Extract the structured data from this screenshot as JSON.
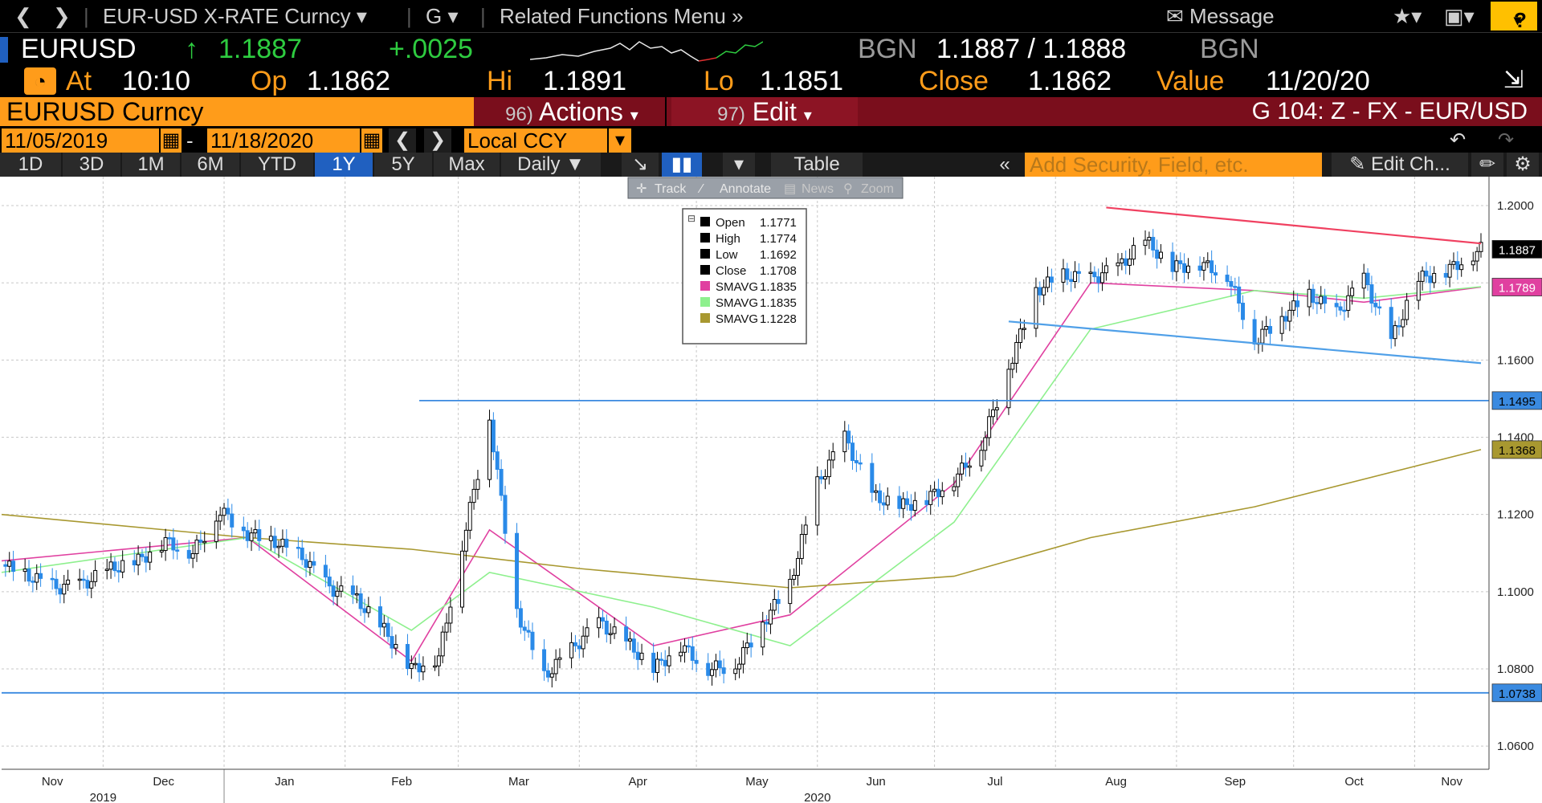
{
  "nav": {
    "ticker_title": "EUR-USD X-RATE Curncy",
    "g_menu": "G",
    "related": "Related Functions Menu",
    "message": "Message",
    "help": "?"
  },
  "quote": {
    "symbol": "EURUSD",
    "arrow": "↑",
    "last": "1.1887",
    "change": "+.0025",
    "source_left": "BGN",
    "bid_ask": "1.1887 / 1.1888",
    "source_right": "BGN"
  },
  "stats": {
    "at_label": "At",
    "at_value": "10:10",
    "op_label": "Op",
    "op_value": "1.1862",
    "hi_label": "Hi",
    "hi_value": "1.1891",
    "lo_label": "Lo",
    "lo_value": "1.1851",
    "close_label": "Close",
    "close_value": "1.1862",
    "value_label": "Value",
    "value_date": "11/20/20"
  },
  "secbar": {
    "name": "EURUSD Curncy",
    "actions_num": "96)",
    "actions": "Actions",
    "edit_num": "97)",
    "edit": "Edit",
    "title": "G 104: Z - FX - EUR/USD"
  },
  "daterange": {
    "start": "11/05/2019",
    "dash": "-",
    "end": "11/18/2020",
    "currency": "Local CCY"
  },
  "periods": [
    "1D",
    "3D",
    "1M",
    "6M",
    "YTD",
    "1Y",
    "5Y",
    "Max"
  ],
  "active_period": "1Y",
  "toolbar": {
    "frequency": "Daily",
    "table": "Table",
    "add_placeholder": "Add Security, Field, etc.",
    "edit_chart": "Edit Ch..."
  },
  "tools": {
    "track": "Track",
    "annotate": "Annotate",
    "news": "News",
    "zoom": "Zoom"
  },
  "legend": [
    {
      "label": "Open",
      "value": "1.1771",
      "color": "#000000"
    },
    {
      "label": "High",
      "value": "1.1774",
      "color": "#000000"
    },
    {
      "label": "Low",
      "value": "1.1692",
      "color": "#000000"
    },
    {
      "label": "Close",
      "value": "1.1708",
      "color": "#000000"
    },
    {
      "label": "SMAVG",
      "value": "1.1835",
      "color": "#e040a0"
    },
    {
      "label": "SMAVG",
      "value": "1.1835",
      "color": "#8ef08e"
    },
    {
      "label": "SMAVG",
      "value": "1.1228",
      "color": "#a89830"
    }
  ],
  "colors": {
    "brand_orange": "#ff9c1a",
    "up_candle": "#000000",
    "down_candle": "#2a8ae8",
    "resistance": "#f04060",
    "support": "#50a0e8",
    "hline": "#3a8ae0",
    "sma_fast": "#e040a0",
    "sma_mid": "#8ef08e",
    "sma_slow": "#a89830"
  },
  "chart_data": {
    "type": "line",
    "title": "",
    "ylim": [
      1.054,
      1.2075
    ],
    "y_ticks": [
      "1.2000",
      "1.1800",
      "1.1600",
      "1.1400",
      "1.1200",
      "1.1000",
      "1.0800",
      "1.0600"
    ],
    "x_month_labels": [
      "Nov",
      "Dec",
      "Jan",
      "Feb",
      "Mar",
      "Apr",
      "May",
      "Jun",
      "Jul",
      "Aug",
      "Sep",
      "Oct",
      "Nov"
    ],
    "x_year_labels": [
      "2019",
      "2020"
    ],
    "series": [
      {
        "name": "",
        "dates": [
          "2019-11-05",
          "2019-11-12",
          "2019-11-19",
          "2019-11-26",
          "2019-12-03",
          "2019-12-10",
          "2019-12-17",
          "2019-12-24",
          "2019-12-31",
          "2020-01-07",
          "2020-01-14",
          "2020-01-21",
          "2020-01-28",
          "2020-02-04",
          "2020-02-11",
          "2020-02-18",
          "2020-02-25",
          "2020-03-02",
          "2020-03-09",
          "2020-03-16",
          "2020-03-23",
          "2020-03-30",
          "2020-04-06",
          "2020-04-13",
          "2020-04-20",
          "2020-04-27",
          "2020-05-04",
          "2020-05-11",
          "2020-05-18",
          "2020-05-25",
          "2020-06-01",
          "2020-06-08",
          "2020-06-15",
          "2020-06-22",
          "2020-06-29",
          "2020-07-06",
          "2020-07-13",
          "2020-07-20",
          "2020-07-27",
          "2020-08-03",
          "2020-08-10",
          "2020-08-17",
          "2020-08-24",
          "2020-08-31",
          "2020-09-07",
          "2020-09-14",
          "2020-09-21",
          "2020-09-28",
          "2020-10-05",
          "2020-10-12",
          "2020-10-19",
          "2020-10-26",
          "2020-11-02",
          "2020-11-09",
          "2020-11-18"
        ],
        "close": [
          1.107,
          1.104,
          1.101,
          1.102,
          1.106,
          1.108,
          1.113,
          1.11,
          1.121,
          1.115,
          1.113,
          1.109,
          1.101,
          1.098,
          1.09,
          1.08,
          1.083,
          1.112,
          1.145,
          1.095,
          1.078,
          1.085,
          1.092,
          1.087,
          1.08,
          1.086,
          1.08,
          1.081,
          1.092,
          1.102,
          1.128,
          1.14,
          1.125,
          1.122,
          1.124,
          1.129,
          1.138,
          1.158,
          1.178,
          1.182,
          1.181,
          1.184,
          1.191,
          1.184,
          1.185,
          1.182,
          1.165,
          1.171,
          1.177,
          1.172,
          1.181,
          1.165,
          1.181,
          1.183,
          1.1887
        ]
      },
      {
        "name": "",
        "dates": [
          "2019-11-05",
          "2020-01-07",
          "2020-02-18",
          "2020-03-09",
          "2020-04-20",
          "2020-05-25",
          "2020-07-06",
          "2020-08-10",
          "2020-09-21",
          "2020-10-19",
          "2020-11-18"
        ],
        "values": [
          1.108,
          1.114,
          1.082,
          1.116,
          1.086,
          1.094,
          1.128,
          1.18,
          1.178,
          1.175,
          1.1789
        ]
      },
      {
        "name": "",
        "dates": [
          "2019-11-05",
          "2020-01-07",
          "2020-02-18",
          "2020-03-09",
          "2020-04-20",
          "2020-05-25",
          "2020-07-06",
          "2020-08-10",
          "2020-09-21",
          "2020-10-19",
          "2020-11-18"
        ],
        "values": [
          1.105,
          1.114,
          1.09,
          1.105,
          1.096,
          1.086,
          1.118,
          1.168,
          1.178,
          1.176,
          1.179
        ]
      },
      {
        "name": "",
        "dates": [
          "2019-11-05",
          "2020-01-07",
          "2020-02-18",
          "2020-04-01",
          "2020-05-25",
          "2020-07-06",
          "2020-08-10",
          "2020-09-21",
          "2020-11-18"
        ],
        "values": [
          1.12,
          1.114,
          1.111,
          1.106,
          1.101,
          1.104,
          1.114,
          1.122,
          1.1368
        ]
      }
    ],
    "horizontal_lines": [
      1.1495,
      1.0738
    ],
    "trendlines": [
      {
        "start": "2020-08-14",
        "start_value": 1.1995,
        "end": "2020-11-18",
        "end_value": 1.1902
      },
      {
        "start": "2020-07-20",
        "start_value": 1.17,
        "end": "2020-11-18",
        "end_value": 1.1592
      }
    ],
    "price_labels": [
      {
        "value": "1.1887",
        "y": 1.1887,
        "bg": "#000000",
        "fg": "#ffffff"
      },
      {
        "value": "1.1789",
        "y": 1.1789,
        "bg": "#e040a0",
        "fg": "#ffffff"
      },
      {
        "value": "1.1495",
        "y": 1.1495,
        "bg": "#3a8ae0",
        "fg": "#000000"
      },
      {
        "value": "1.1368",
        "y": 1.1368,
        "bg": "#a89830",
        "fg": "#000000"
      },
      {
        "value": "1.0738",
        "y": 1.0738,
        "bg": "#3a8ae0",
        "fg": "#000000"
      }
    ],
    "grid": true,
    "legend_position": "top-left"
  }
}
